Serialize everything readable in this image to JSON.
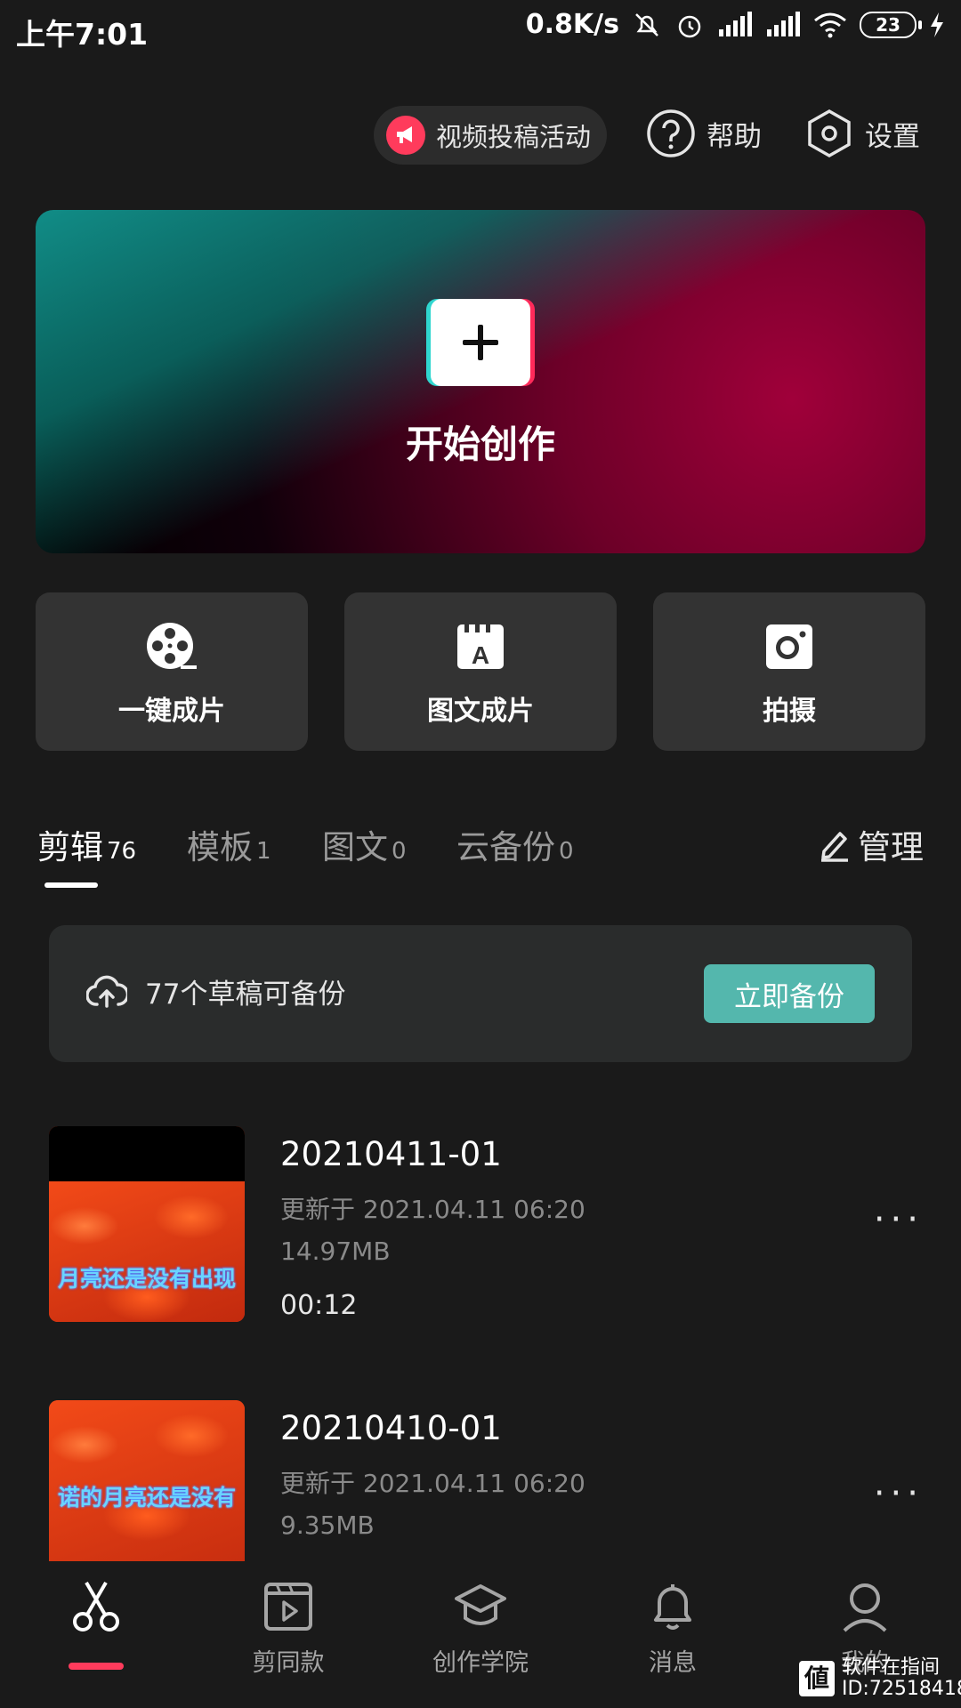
{
  "status_bar": {
    "time": "上午7:01",
    "network_speed": "0.8K/s",
    "battery": "23"
  },
  "top_actions": {
    "campaign_label": "视频投稿活动",
    "help_label": "帮助",
    "settings_label": "设置"
  },
  "banner": {
    "label": "开始创作"
  },
  "quick_actions": [
    {
      "label": "一键成片",
      "icon": "film-reel-icon"
    },
    {
      "label": "图文成片",
      "icon": "text-clapper-icon"
    },
    {
      "label": "拍摄",
      "icon": "camera-icon"
    }
  ],
  "tabs": [
    {
      "label": "剪辑",
      "count": "76",
      "active": true
    },
    {
      "label": "模板",
      "count": "1"
    },
    {
      "label": "图文",
      "count": "0"
    },
    {
      "label": "云备份",
      "count": "0"
    }
  ],
  "manage_label": "管理",
  "backup": {
    "text": "77个草稿可备份",
    "button": "立即备份"
  },
  "drafts": [
    {
      "title": "20210411-01",
      "updated": "更新于 2021.04.11 06:20",
      "size": "14.97MB",
      "duration": "00:12",
      "subtitle": "月亮还是没有出现"
    },
    {
      "title": "20210410-01",
      "updated": "更新于 2021.04.11 06:20",
      "size": "9.35MB",
      "subtitle": "诺的月亮还是没有"
    }
  ],
  "more_label": "···",
  "bottom_nav": [
    {
      "label": "",
      "icon": "scissors-icon",
      "active": true
    },
    {
      "label": "剪同款",
      "icon": "template-play-icon"
    },
    {
      "label": "创作学院",
      "icon": "graduation-cap-icon"
    },
    {
      "label": "消息",
      "icon": "bell-icon"
    },
    {
      "label": "我的",
      "icon": "profile-icon"
    }
  ],
  "watermark": {
    "logo": "値",
    "line1": "软件在指间",
    "line2": "ID:72518418"
  },
  "colors": {
    "background": "#1a1a1a",
    "accent_red": "#ff3b5c",
    "backup_button": "#54b7ad"
  }
}
